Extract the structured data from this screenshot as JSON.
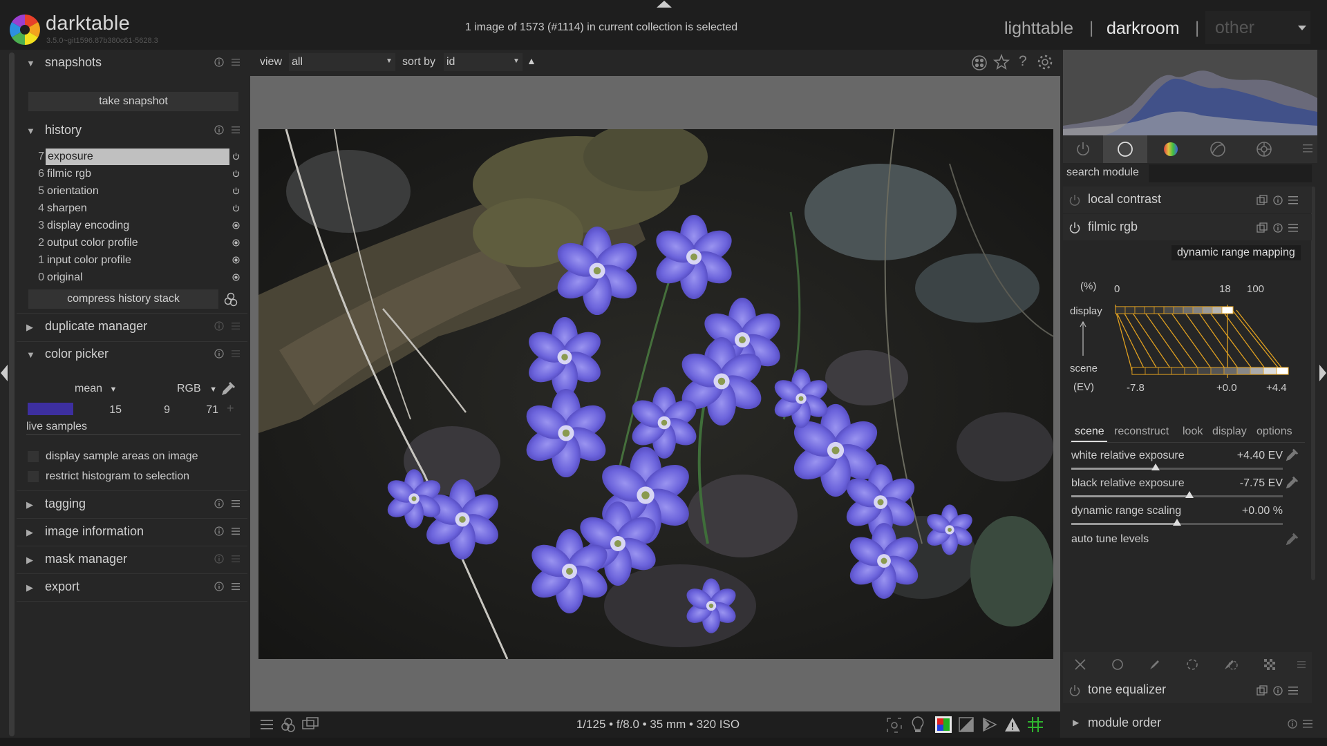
{
  "app": {
    "name": "darktable",
    "version": "3.5.0~git1596.87b380c61-5628.3",
    "status": "1 image of 1573 (#1114) in current collection is selected"
  },
  "views": {
    "lighttable": "lighttable",
    "darkroom": "darkroom",
    "other": "other",
    "sep": "|"
  },
  "left": {
    "snapshots": {
      "title": "snapshots",
      "take_snapshot": "take snapshot"
    },
    "history": {
      "title": "history",
      "items": [
        {
          "num": "7",
          "name": "exposure",
          "selected": true
        },
        {
          "num": "6",
          "name": "filmic rgb"
        },
        {
          "num": "5",
          "name": "orientation"
        },
        {
          "num": "4",
          "name": "sharpen"
        },
        {
          "num": "3",
          "name": "display encoding"
        },
        {
          "num": "2",
          "name": "output color profile"
        },
        {
          "num": "1",
          "name": "input color profile"
        },
        {
          "num": "0",
          "name": "original"
        }
      ],
      "compress": "compress history stack"
    },
    "duplicate_manager": "duplicate manager",
    "color_picker": {
      "title": "color picker",
      "mode": "mean",
      "space": "RGB",
      "swatch": "#3d2fa0",
      "values": [
        "15",
        "9",
        "71"
      ],
      "live_samples": "live samples",
      "display_sample": "display sample areas on image",
      "restrict_hist": "restrict histogram to selection"
    },
    "tagging": "tagging",
    "image_information": "image information",
    "mask_manager": "mask manager",
    "export": "export"
  },
  "center": {
    "view_label": "view",
    "view_value": "all",
    "sort_label": "sort by",
    "sort_value": "id",
    "exif": "1/125 • f/8.0 • 35 mm • 320 ISO"
  },
  "right": {
    "search_label": "search module",
    "search_value": "",
    "local_contrast": "local contrast",
    "filmic": {
      "title": "filmic rgb",
      "graph_title": "dynamic range mapping",
      "pct": "(%)",
      "display": "display",
      "scene": "scene",
      "ev": "(EV)",
      "top_ticks": [
        "0",
        "18",
        "100"
      ],
      "bottom_ticks": [
        "-7.8",
        "+0.0",
        "+4.4"
      ],
      "tabs": [
        "scene",
        "reconstruct",
        "look",
        "display",
        "options"
      ],
      "sliders": [
        {
          "label": "white relative exposure",
          "value": "+4.40 EV",
          "pos": 0.4
        },
        {
          "label": "black relative exposure",
          "value": "-7.75 EV",
          "pos": 0.56
        },
        {
          "label": "dynamic range scaling",
          "value": "+0.00 %",
          "pos": 0.5
        }
      ],
      "auto_tune": "auto tune levels"
    },
    "tone_equalizer": "tone equalizer",
    "module_order": "module order"
  }
}
